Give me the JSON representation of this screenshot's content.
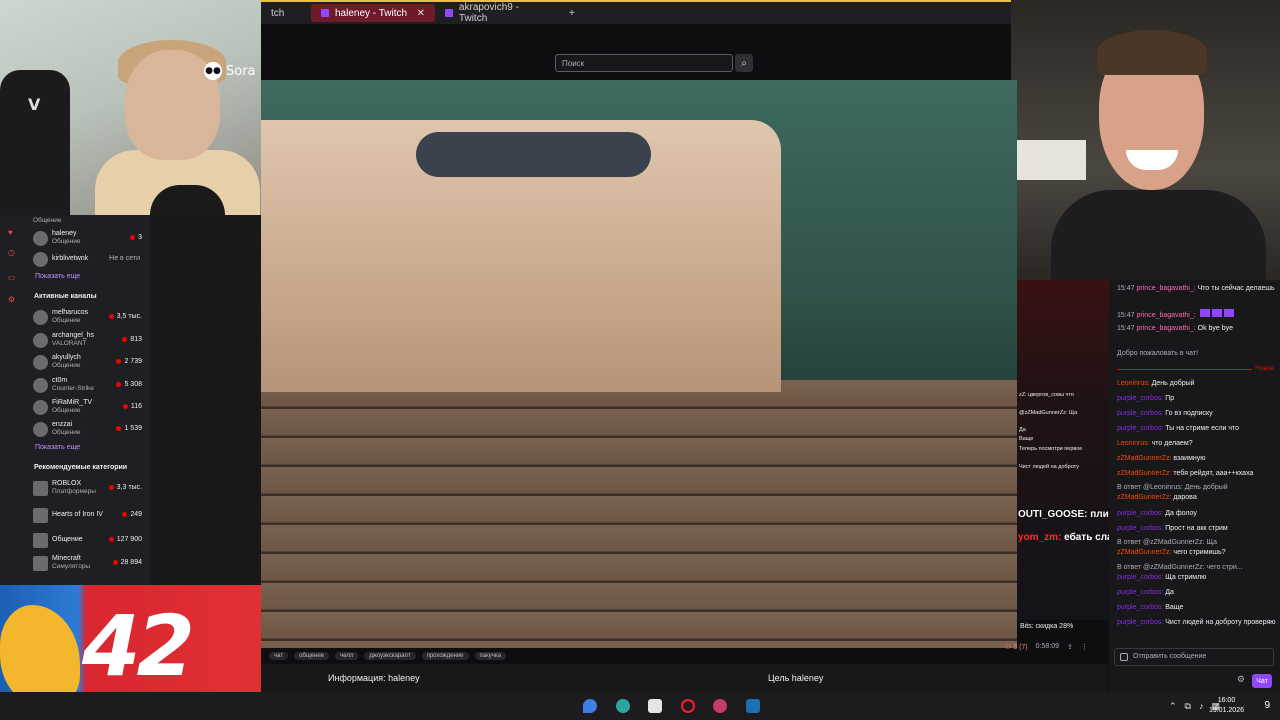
{
  "webcam_left": {
    "overlay_text": "Sora"
  },
  "browser": {
    "tabs": [
      {
        "label": "tch",
        "active": false
      },
      {
        "label": "haleney - Twitch",
        "active": true
      },
      {
        "label": "akrapovich9 - Twitch",
        "active": false
      }
    ],
    "new_tab": "+"
  },
  "header": {
    "search_placeholder": "Поиск"
  },
  "sidebar": {
    "top_game": "Общение",
    "followed": [
      {
        "name": "haleney",
        "game": "Общение",
        "viewers": "3"
      },
      {
        "name": "kirblivetwnk",
        "game": "",
        "status": "Не в сети"
      }
    ],
    "show_more_1": "Показать еще",
    "active_header": "Активные каналы",
    "active": [
      {
        "name": "melharucos",
        "game": "Общение",
        "viewers": "3,5 тыс."
      },
      {
        "name": "archangel_hs",
        "game": "VALORANT",
        "viewers": "813"
      },
      {
        "name": "akyullych",
        "game": "Общение",
        "viewers": "2 739"
      },
      {
        "name": "ct0m",
        "game": "Counter-Strike",
        "viewers": "5 308"
      },
      {
        "name": "FiRaMiR_TV",
        "game": "Общение",
        "viewers": "116"
      },
      {
        "name": "enzzai",
        "game": "Общение",
        "viewers": "1 539"
      }
    ],
    "show_more_2": "Показать еще",
    "categories_header": "Рекомендуемые категории",
    "categories": [
      {
        "name": "ROBLOX",
        "tag": "Платформеры",
        "viewers": "3,3 тыс."
      },
      {
        "name": "Hearts of Iron IV",
        "tag": "",
        "viewers": "249"
      },
      {
        "name": "Общение",
        "tag": "",
        "viewers": "127 900"
      },
      {
        "name": "Minecraft",
        "tag": "Симуляторы",
        "viewers": "28 894"
      }
    ]
  },
  "ad": {
    "number": "42"
  },
  "stream": {
    "tags": [
      "чат",
      "общение",
      "челл",
      "джоуэкскарапт",
      "прохождение",
      "пакучка"
    ],
    "viewers": "3 (7)",
    "uptime": "0:58:09",
    "info_label": "Информация: haleney",
    "goal_label": "Цель haleney"
  },
  "overlay": {
    "lines": [
      "zZ: цвергов_совы что",
      "@zZMadGunnerZz: Ща",
      "Да",
      "Ваще",
      "Теперь посмотри первое",
      "Чист людей на доброту"
    ],
    "big_1": "OUTI_GOOSE: плиз",
    "big_2_name": "yom_zm:",
    "big_2_text": "ебать слава україні лигенда",
    "bits": "Bits: скидка 28%"
  },
  "chat": {
    "earlier": [
      {
        "time": "15:47",
        "user": "prince_bagavathi_:",
        "text": "Что ты сейчас делаешь",
        "color": "n4"
      },
      {
        "time": "15:47",
        "user": "prince_bagavathi_:",
        "text": "",
        "color": "n4"
      },
      {
        "time": "15:47",
        "user": "prince_bagavathi_:",
        "text": "Ok bye bye",
        "color": "n4"
      }
    ],
    "welcome": "Добро пожаловать в чат!",
    "new_label": "Новое",
    "messages": [
      {
        "user": "Leoninrus:",
        "text": "День добрый",
        "color": "n1"
      },
      {
        "user": "purple_corbos:",
        "text": "Пр",
        "color": "n2"
      },
      {
        "user": "purple_corbos:",
        "text": "Го вз подписку",
        "color": "n2"
      },
      {
        "user": "purple_corbos:",
        "text": "Ты на стриме если что",
        "color": "n2"
      },
      {
        "user": "Leoninrus:",
        "text": "что делаем?",
        "color": "n1"
      },
      {
        "user": "zZMadGunnerZz:",
        "text": "взаимную",
        "color": "n1"
      },
      {
        "user": "zZMadGunnerZz:",
        "text": "тебя рейдят, ааа++кхаха",
        "color": "n1"
      },
      {
        "user": "",
        "text": "В ответ @Leoninrus: День добрый",
        "color": ""
      },
      {
        "user": "zZMadGunnerZz:",
        "text": "дарова",
        "color": "n1"
      },
      {
        "user": "purple_corbos:",
        "text": "Да фолоу",
        "color": "n2"
      },
      {
        "user": "purple_corbos:",
        "text": "Прост на акк стрим",
        "color": "n2"
      },
      {
        "user": "",
        "text": "В ответ @zZMadGunnerZz: Ща",
        "color": ""
      },
      {
        "user": "zZMadGunnerZz:",
        "text": "чего стримишь?",
        "color": "n1"
      },
      {
        "user": "",
        "text": "В ответ @zZMadGunnerZz: чего стри...",
        "color": ""
      },
      {
        "user": "purple_corbos:",
        "text": "Ща стримлю",
        "color": "n2"
      },
      {
        "user": "purple_corbos:",
        "text": "Да",
        "color": "n2"
      },
      {
        "user": "purple_corbos:",
        "text": "Ваще",
        "color": "n2"
      },
      {
        "user": "purple_corbos:",
        "text": "Чист людей на доброту проверяю",
        "color": "n2"
      }
    ],
    "input_placeholder": "Отправить сообщение",
    "send_label": "Чат"
  },
  "taskbar": {
    "time": "16:00",
    "date": "19.01.2026",
    "notifications": "9"
  }
}
